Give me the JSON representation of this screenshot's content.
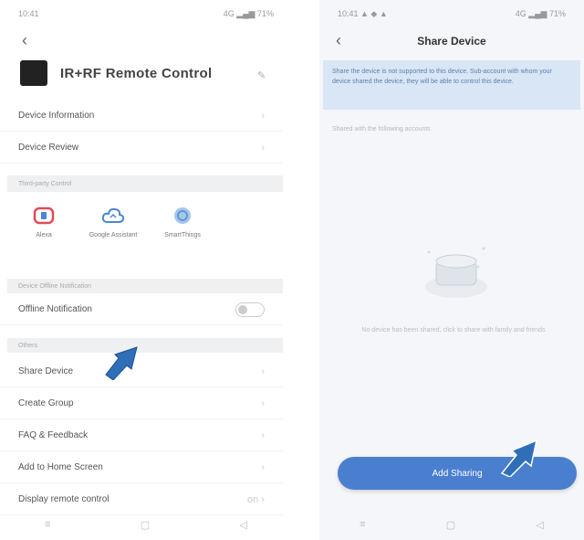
{
  "left": {
    "status_left": "10:41",
    "status_right": "4G ▂▄▆ 71%",
    "back_icon": "chevron-left",
    "device_title": "IR+RF Remote Control",
    "menu_top": [
      {
        "label": "Device Information"
      },
      {
        "label": "Device Review"
      }
    ],
    "section_quick": "Third-party Control",
    "quick_actions": [
      {
        "label": "Alexa",
        "icon": "alexa-icon",
        "color": "#e04b5a"
      },
      {
        "label": "Google Assistant",
        "icon": "cloud-icon",
        "color": "#4a86d4"
      },
      {
        "label": "SmartThings",
        "icon": "smartthings-icon",
        "color": "#5a9ad8"
      }
    ],
    "section_notification": "Device Offline Notification",
    "offline_label": "Offline Notification",
    "section_others": "Others",
    "menu_others": [
      {
        "label": "Share Device"
      },
      {
        "label": "Create Group"
      },
      {
        "label": "FAQ & Feedback"
      },
      {
        "label": "Add to Home Screen"
      },
      {
        "label": "Display remote control",
        "extra": "on"
      }
    ]
  },
  "right": {
    "status_left": "10:41 ▲ ◆ ▲",
    "status_right": "4G ▂▄▆ 71%",
    "back_icon": "chevron-left",
    "title": "Share Device",
    "banner_text": "Share the device is not supported to this device. Sub-account with whom your device shared the device, they will be able to control this device.",
    "subnote": "Shared with the following accounts",
    "empty_text": "No device has been shared, click to share with family and friends",
    "add_button": "Add Sharing"
  },
  "colors": {
    "accent": "#4a7fcf",
    "arrow": "#2f6fb8"
  }
}
